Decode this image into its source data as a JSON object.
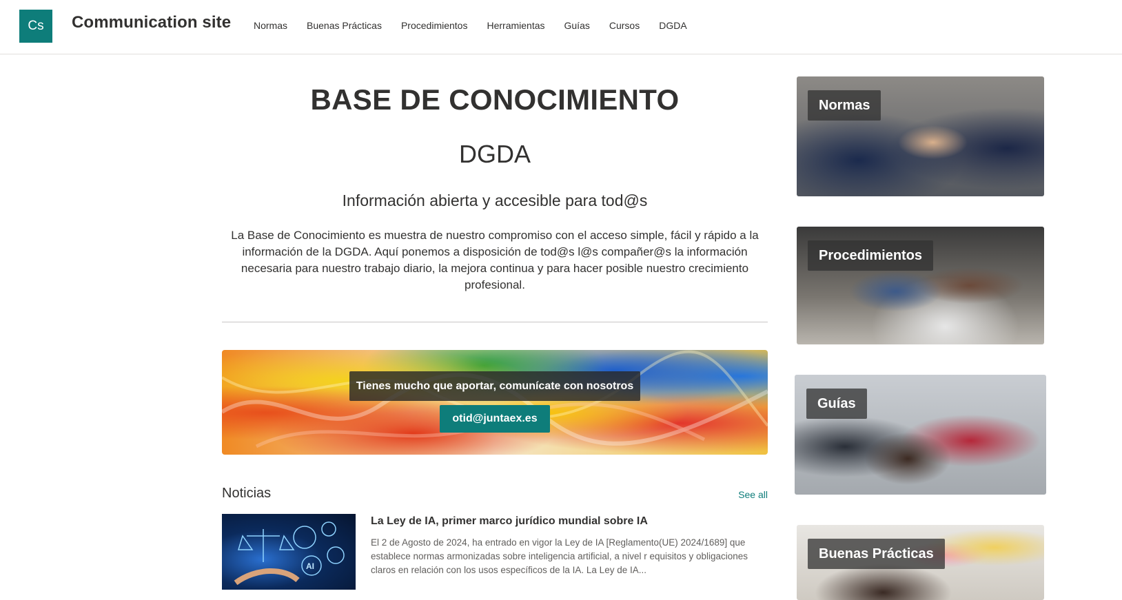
{
  "header": {
    "logo_text": "Cs",
    "site_title": "Communication site",
    "nav": [
      "Normas",
      "Buenas Prácticas",
      "Procedimientos",
      "Herramientas",
      "Guías",
      "Cursos",
      "DGDA"
    ]
  },
  "hero": {
    "title": "BASE DE CONOCIMIENTO",
    "subtitle": "DGDA",
    "tagline": "Información abierta y accesible para tod@s",
    "description": "La Base de Conocimiento es muestra de nuestro compromiso con el acceso simple, fácil y rápido a la información de la DGDA. Aquí ponemos a disposición de tod@s l@s compañer@s la información necesaria para nuestro trabajo diario, la mejora continua y para hacer posible nuestro crecimiento profesional."
  },
  "banner": {
    "message": "Tienes mucho que aportar, comunícate con nosotros",
    "email_button": "otid@juntaex.es"
  },
  "news": {
    "section_title": "Noticias",
    "see_all": "See all",
    "items": [
      {
        "headline": "La Ley de IA, primer marco jurídico mundial sobre IA",
        "snippet": "El 2 de Agosto de 2024, ha entrado en vigor la Ley de IA [Reglamento(UE) 2024/1689] que establece normas armonizadas sobre inteligencia artificial, a nivel r equisitos y obligaciones claros en relación con los usos específicos de la IA. La Ley de IA...",
        "thumb_text": "AI"
      }
    ]
  },
  "tiles": [
    {
      "label": "Normas"
    },
    {
      "label": "Procedimientos"
    },
    {
      "label": "Guías"
    },
    {
      "label": "Buenas Prácticas"
    }
  ],
  "colors": {
    "accent": "#0e7d7a",
    "text": "#323130",
    "muted": "#605e5c"
  }
}
